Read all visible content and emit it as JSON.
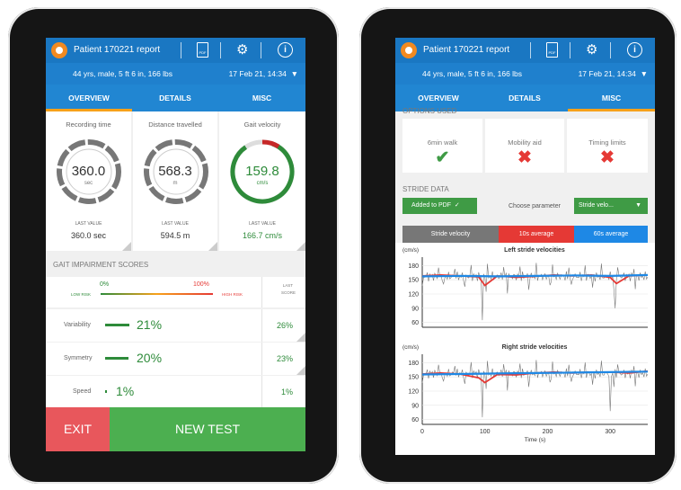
{
  "app": {
    "title": "Patient 170221 report",
    "pdf_icon_label": "PDF",
    "patient_info": "44 yrs, male, 5 ft 6 in, 166 lbs",
    "date": "17 Feb 21, 14:34",
    "dropdown_glyph": "▼"
  },
  "tabs": [
    {
      "label": "OVERVIEW"
    },
    {
      "label": "DETAILS"
    },
    {
      "label": "MISC"
    }
  ],
  "left": {
    "active_tab": "OVERVIEW",
    "metrics": [
      {
        "title": "Recording time",
        "value": "360.0",
        "unit": "sec",
        "last_label": "LAST VALUE",
        "last_value": "360.0 sec",
        "fill": 1.0,
        "color": "#777777"
      },
      {
        "title": "Distance travelled",
        "value": "568.3",
        "unit": "m",
        "last_label": "LAST VALUE",
        "last_value": "594.5 m",
        "fill": 0.95,
        "color": "#777777"
      },
      {
        "title": "Gait velocity",
        "value": "159.8",
        "unit": "cm/s",
        "last_label": "LAST VALUE",
        "last_value": "166.7 cm/s",
        "fill": 0.85,
        "color": "#2e8b3a"
      }
    ],
    "gait_section_title": "GAIT IMPAIRMENT SCORES",
    "scale": {
      "min_label": "0%",
      "max_label": "100%",
      "low_label": "LOW RISK",
      "high_label": "HIGH RISK",
      "last_header_1": "LAST",
      "last_header_2": "SCORE"
    },
    "scores": [
      {
        "label": "Variability",
        "value": "21%",
        "last": "26%",
        "fraction": 0.21
      },
      {
        "label": "Symmetry",
        "value": "20%",
        "last": "23%",
        "fraction": 0.2
      },
      {
        "label": "Speed",
        "value": "1%",
        "last": "1%",
        "fraction": 0.01
      }
    ],
    "exit_label": "EXIT",
    "new_test_label": "NEW TEST"
  },
  "right": {
    "active_tab": "MISC",
    "options_title": "OPTIONS USED",
    "options": [
      {
        "label": "6min walk",
        "mark": "✔",
        "state": "yes"
      },
      {
        "label": "Mobility aid",
        "mark": "✖",
        "state": "no"
      },
      {
        "label": "Timing limits",
        "mark": "✖",
        "state": "no"
      }
    ],
    "stride_title": "STRIDE DATA",
    "added_pdf_label": "Added to PDF",
    "added_pdf_check": "✓",
    "choose_label": "Choose parameter",
    "param_select": "Stride velo...",
    "legend": [
      {
        "label": "Stride velocity",
        "color": "#777777"
      },
      {
        "label": "10s average",
        "color": "#e53935"
      },
      {
        "label": "60s average",
        "color": "#1e88e5"
      }
    ]
  },
  "chart_data": [
    {
      "type": "line",
      "title": "Left stride velocities",
      "ylabel": "(cm/s)",
      "yticks": [
        "180",
        "150",
        "120",
        "90",
        "60"
      ],
      "ylim": [
        50,
        190
      ],
      "xlim": [
        0,
        360
      ],
      "series": [
        {
          "name": "10s average",
          "x": [
            0,
            30,
            60,
            90,
            100,
            120,
            150,
            180,
            210,
            240,
            270,
            300,
            310,
            330,
            360
          ],
          "y": [
            158,
            160,
            158,
            156,
            138,
            158,
            155,
            157,
            160,
            158,
            160,
            155,
            142,
            158,
            160
          ]
        },
        {
          "name": "60s average",
          "x": [
            0,
            60,
            120,
            180,
            240,
            300,
            360
          ],
          "y": [
            157,
            158,
            157,
            158,
            159,
            158,
            160
          ]
        }
      ]
    },
    {
      "type": "line",
      "title": "Right stride velocities",
      "ylabel": "(cm/s)",
      "xlabel": "Time (s)",
      "yticks": [
        "180",
        "150",
        "120",
        "90",
        "60"
      ],
      "xticks": [
        "0",
        "100",
        "200",
        "300"
      ],
      "ylim": [
        50,
        190
      ],
      "xlim": [
        0,
        360
      ],
      "series": [
        {
          "name": "10s average",
          "x": [
            0,
            30,
            60,
            90,
            100,
            120,
            150,
            180,
            210,
            240,
            270,
            300,
            330,
            360
          ],
          "y": [
            156,
            158,
            156,
            148,
            138,
            155,
            154,
            158,
            160,
            158,
            160,
            160,
            158,
            162
          ]
        },
        {
          "name": "60s average",
          "x": [
            0,
            60,
            120,
            180,
            240,
            300,
            360
          ],
          "y": [
            155,
            156,
            157,
            158,
            159,
            160,
            161
          ]
        }
      ]
    }
  ]
}
